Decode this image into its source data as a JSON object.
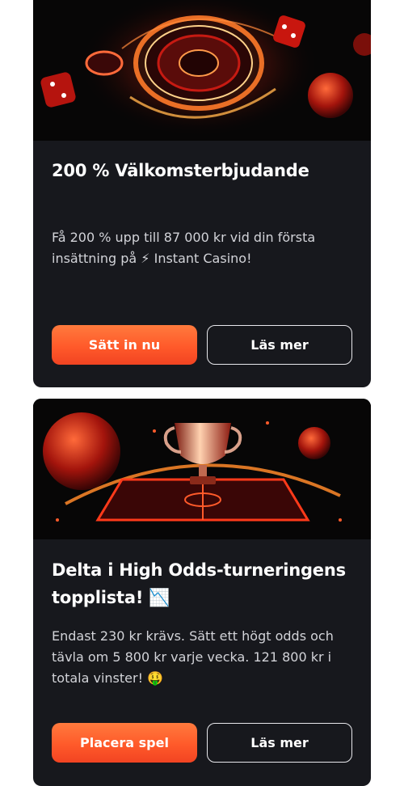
{
  "cards": [
    {
      "title": "200 % Välkomsterbjudande",
      "description": "Få 200 % upp till 87 000 kr vid din första insättning på ⚡ Instant Casino!",
      "primary_button": "Sätt in nu",
      "secondary_button": "Läs mer",
      "image_icon": "roulette-wheel-dice-football-image"
    },
    {
      "title": "Delta i High Odds-turneringens topplista! 📉",
      "description": "Endast 230 kr krävs. Sätt ett högt odds och tävla om 5 800 kr varje vecka. 121 800 kr i totala vinster! 🤑",
      "primary_button": "Placera spel",
      "secondary_button": "Läs mer",
      "image_icon": "trophy-football-field-image"
    }
  ],
  "colors": {
    "card_background": "#17181d",
    "accent_orange": "#ff5a2a",
    "text_primary": "#ffffff",
    "text_secondary": "#d2d3d8"
  }
}
